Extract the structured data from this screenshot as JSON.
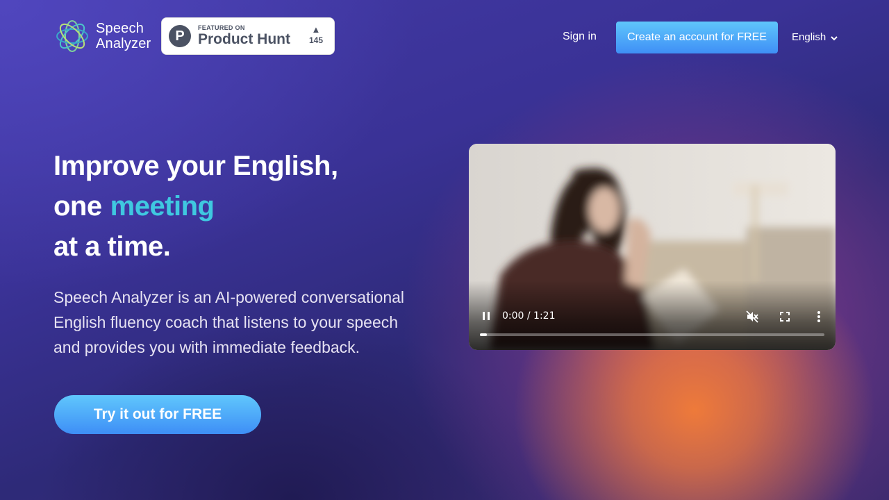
{
  "header": {
    "logo_line1": "Speech",
    "logo_line2": "Analyzer",
    "product_hunt": {
      "featured_label": "FEATURED ON",
      "name": "Product Hunt",
      "letter": "P",
      "arrow": "▲",
      "votes": "145"
    },
    "sign_in": "Sign in",
    "create_account": "Create an account for FREE",
    "language": "English"
  },
  "hero": {
    "headline_line1": "Improve your English,",
    "headline_line2_prefix": "one",
    "headline_line2_accent": "meeting",
    "headline_line3": "at a time.",
    "description": "Speech Analyzer is an AI-powered conversational English fluency coach that listens to your speech and provides you with immediate feedback.",
    "cta": "Try it out for FREE"
  },
  "video": {
    "time": "0:00 / 1:21",
    "progress": 0.02,
    "state": "playing",
    "muted": true
  },
  "colors": {
    "accent_text": "#3fc8e0",
    "button_top": "#5fc6fb",
    "button_bottom": "#3f8ff6"
  }
}
